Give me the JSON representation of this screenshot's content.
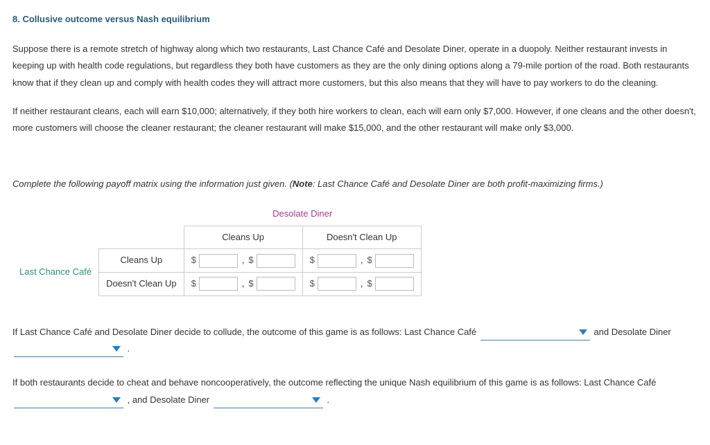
{
  "heading": "8. Collusive outcome versus Nash equilibrium",
  "p1": "Suppose there is a remote stretch of highway along which two restaurants, Last Chance Café and Desolate Diner, operate in a duopoly. Neither restaurant invests in keeping up with health code regulations, but regardless they both have customers as they are the only dining options along a 79-mile portion of the road. Both restaurants know that if they clean up and comply with health codes they will attract more customers, but this also means that they will have to pay workers to do the cleaning.",
  "p2": "If neither restaurant cleans, each will earn $10,000; alternatively, if they both hire workers to clean, each will earn only $7,000. However, if one cleans and the other doesn't, more customers will choose the cleaner restaurant; the cleaner restaurant will make $15,000, and the other restaurant will make only $3,000.",
  "instruction_pre": "Complete the following payoff matrix using the information just given. (",
  "instruction_note": "Note",
  "instruction_post": ": Last Chance Café and Desolate Diner are both profit-maximizing firms.)",
  "matrix": {
    "col_player": "Desolate Diner",
    "row_player": "Last Chance Café",
    "col_labels": [
      "Cleans Up",
      "Doesn't Clean Up"
    ],
    "row_labels": [
      "Cleans Up",
      "Doesn't Clean Up"
    ],
    "currency": "$",
    "comma": ","
  },
  "q1": {
    "pre": "If Last Chance Café and Desolate Diner decide to collude, the outcome of this game is as follows: Last Chance Café ",
    "mid": " and Desolate Diner ",
    "end": " ."
  },
  "q2": {
    "pre": "If both restaurants decide to cheat and behave noncooperatively, the outcome reflecting the unique Nash equilibrium of this game is as follows: Last Chance Café ",
    "mid": " , and Desolate Diner ",
    "end": " ."
  }
}
